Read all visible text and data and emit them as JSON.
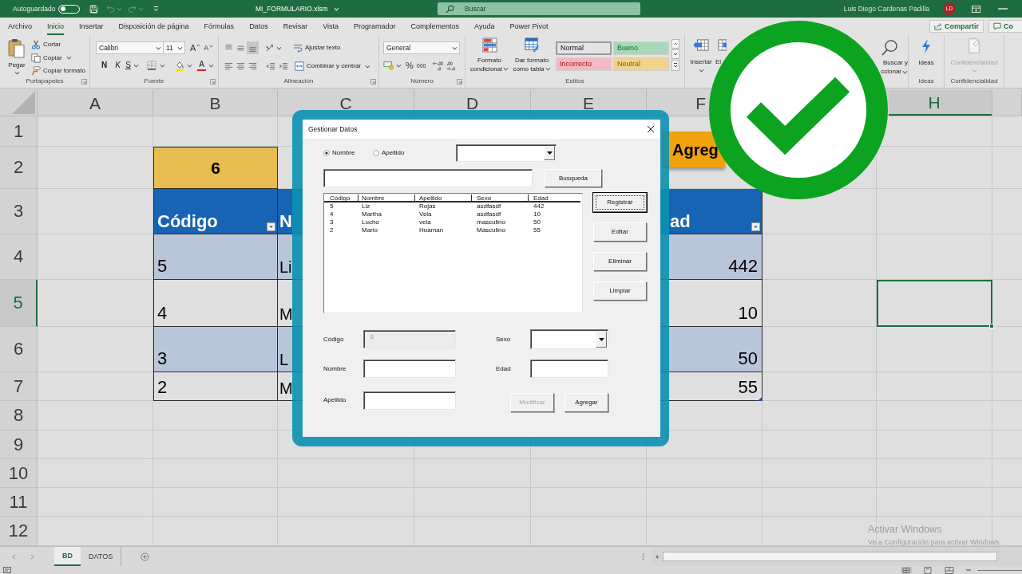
{
  "title_bar": {
    "autosave_label": "Autoguardado",
    "autosave_on": false,
    "file_name": "MI_FORMULARIO.xlsm",
    "search_placeholder": "Buscar",
    "user_name": "Luis Diego Cardenas Padilla",
    "user_initials": "LD"
  },
  "ribbon_tabs": [
    {
      "label": "Archivo",
      "selected": false
    },
    {
      "label": "Inicio",
      "selected": true
    },
    {
      "label": "Insertar",
      "selected": false
    },
    {
      "label": "Disposición de página",
      "selected": false
    },
    {
      "label": "Fórmulas",
      "selected": false
    },
    {
      "label": "Datos",
      "selected": false
    },
    {
      "label": "Revisar",
      "selected": false
    },
    {
      "label": "Vista",
      "selected": false
    },
    {
      "label": "Programador",
      "selected": false
    },
    {
      "label": "Complementos",
      "selected": false
    },
    {
      "label": "Ayuda",
      "selected": false
    },
    {
      "label": "Power Pivot",
      "selected": false
    }
  ],
  "share_button": "Compartir",
  "comments_button": "Co",
  "ribbon": {
    "clipboard": {
      "label": "Portapapeles",
      "paste": "Pegar",
      "cut": "Cortar",
      "copy": "Copiar",
      "format_painter": "Copiar formato"
    },
    "font": {
      "label": "Fuente",
      "font_name": "Calibri",
      "font_size": "11",
      "grow": "A",
      "shrink": "A",
      "bold": "N",
      "italic": "K",
      "underline": "S",
      "font_color": "A"
    },
    "alignment": {
      "label": "Alineación",
      "vertical": [
        {
          "selected": false
        },
        {
          "selected": false
        },
        {
          "selected": true
        }
      ],
      "wrap_text": "Ajustar texto",
      "merge": "Combinar y centrar"
    },
    "number": {
      "label": "Número",
      "format": "General",
      "percent": "%",
      "thousands": "000"
    },
    "styles": {
      "label": "Estilos",
      "conditional": "Formato condicional",
      "table": "Dar formato como tabla",
      "cell_styles": [
        {
          "label": "Normal",
          "color": "#e4e4e4",
          "selected": true
        },
        {
          "label": "Bueno",
          "color": "#a8d8b5",
          "selected": false
        },
        {
          "label": "Incorrecto",
          "color": "#f3b9c1",
          "selected": false
        },
        {
          "label": "Neutral",
          "color": "#f1d38d",
          "selected": false
        }
      ]
    },
    "cells": {
      "insert": "Insertar",
      "delete": "El"
    },
    "editing": {
      "find_line1": "Buscar y",
      "find_line2": "ccionar"
    },
    "ideas": {
      "label": "Ideas",
      "button": "Ideas"
    },
    "sensitivity": {
      "label": "Confidencialidad",
      "button": "Confidencialidad",
      "disabled": true
    }
  },
  "sheet": {
    "columns": [
      {
        "label": "A",
        "selected": false
      },
      {
        "label": "B",
        "selected": false
      },
      {
        "label": "C",
        "selected": false
      },
      {
        "label": "D",
        "selected": false
      },
      {
        "label": "E",
        "selected": false
      },
      {
        "label": "F",
        "selected": false
      },
      {
        "label": "H",
        "selected": true
      }
    ],
    "rows": [
      {
        "label": "1",
        "selected": false
      },
      {
        "label": "2",
        "selected": false
      },
      {
        "label": "3",
        "selected": false
      },
      {
        "label": "4",
        "selected": false
      },
      {
        "label": "5",
        "selected": true
      },
      {
        "label": "6",
        "selected": false
      },
      {
        "label": "7",
        "selected": false
      },
      {
        "label": "8",
        "selected": false
      },
      {
        "label": "9",
        "selected": false
      },
      {
        "label": "10",
        "selected": false
      },
      {
        "label": "11",
        "selected": false
      },
      {
        "label": "12",
        "selected": false
      }
    ],
    "code_cell": "6",
    "table": {
      "headers": [
        "Código",
        "N",
        "ad"
      ],
      "rows": [
        [
          "5",
          "Li",
          "442"
        ],
        [
          "4",
          "M",
          "10"
        ],
        [
          "3",
          "L",
          "50"
        ],
        [
          "2",
          "M",
          "55"
        ]
      ]
    },
    "macro_button": "Agreg",
    "tabs": [
      {
        "label": "BD",
        "selected": true
      },
      {
        "label": "DATOS",
        "selected": false
      }
    ]
  },
  "activation_notice": {
    "title": "Activar Windows",
    "message": "Ve a Configuración para activar Windows."
  },
  "dialog": {
    "title": "Gestionar Datos",
    "search_options": [
      {
        "label": "Nombre",
        "selected": true
      },
      {
        "label": "Apellido",
        "selected": false
      }
    ],
    "search_button": "Busqueda",
    "list": {
      "columns": [
        "Código",
        "Nombre",
        "Apellido",
        "Sexo",
        "Edad"
      ],
      "rows": [
        [
          "5",
          "Liz",
          "Rojas",
          "asdfasdf",
          "442"
        ],
        [
          "4",
          "Martha",
          "Vela",
          "asdfasdf",
          "10"
        ],
        [
          "3",
          "Lucho",
          "vela",
          "masculino",
          "50"
        ],
        [
          "2",
          "Mario",
          "Huaman",
          "Masculino",
          "55"
        ]
      ]
    },
    "side_buttons": [
      {
        "label": "Registrar",
        "focused": true
      },
      {
        "label": "Editar",
        "focused": false
      },
      {
        "label": "Eliminar",
        "focused": false
      },
      {
        "label": "Limpiar",
        "focused": false
      }
    ],
    "fields": [
      {
        "label": "Código",
        "kind": "text",
        "value": "6",
        "disabled": true
      },
      {
        "label": "Sexo",
        "kind": "combo",
        "disabled": false
      },
      {
        "label": "Nombre",
        "kind": "text",
        "disabled": false
      },
      {
        "label": "Edad",
        "kind": "text",
        "disabled": false
      },
      {
        "label": "Apellido",
        "kind": "text",
        "disabled": false
      }
    ],
    "action_buttons": [
      {
        "label": "Modificar",
        "disabled": true
      },
      {
        "label": "Agregar",
        "disabled": false
      }
    ]
  }
}
